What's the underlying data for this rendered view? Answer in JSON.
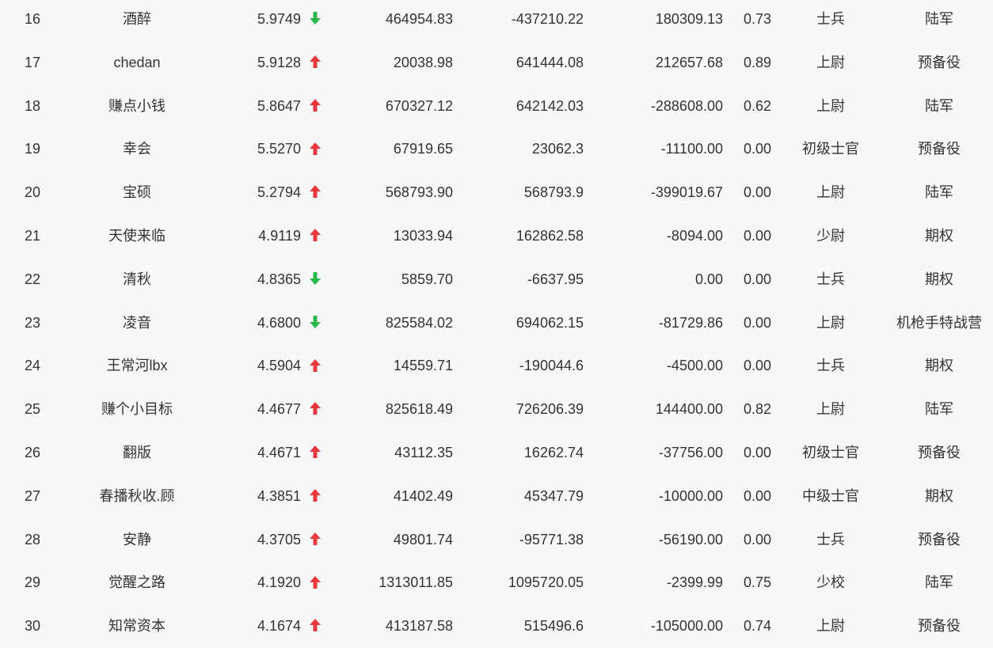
{
  "colors": {
    "up": "#e8383d",
    "down": "#29b84a",
    "text": "#333333",
    "background": "#f7f8fa"
  },
  "rows": [
    {
      "rank": "16",
      "name": "酒醉",
      "ratio": "5.9749",
      "trend": "down",
      "v1": "464954.83",
      "v2": "-437210.22",
      "v3": "180309.13",
      "v4": "0.73",
      "title": "士兵",
      "group": "陆军"
    },
    {
      "rank": "17",
      "name": "chedan",
      "ratio": "5.9128",
      "trend": "up",
      "v1": "20038.98",
      "v2": "641444.08",
      "v3": "212657.68",
      "v4": "0.89",
      "title": "上尉",
      "group": "预备役"
    },
    {
      "rank": "18",
      "name": "赚点小钱",
      "ratio": "5.8647",
      "trend": "up",
      "v1": "670327.12",
      "v2": "642142.03",
      "v3": "-288608.00",
      "v4": "0.62",
      "title": "上尉",
      "group": "陆军"
    },
    {
      "rank": "19",
      "name": "幸会",
      "ratio": "5.5270",
      "trend": "up",
      "v1": "67919.65",
      "v2": "23062.3",
      "v3": "-11100.00",
      "v4": "0.00",
      "title": "初级士官",
      "group": "预备役"
    },
    {
      "rank": "20",
      "name": "宝硕",
      "ratio": "5.2794",
      "trend": "up",
      "v1": "568793.90",
      "v2": "568793.9",
      "v3": "-399019.67",
      "v4": "0.00",
      "title": "上尉",
      "group": "陆军"
    },
    {
      "rank": "21",
      "name": "天使来临",
      "ratio": "4.9119",
      "trend": "up",
      "v1": "13033.94",
      "v2": "162862.58",
      "v3": "-8094.00",
      "v4": "0.00",
      "title": "少尉",
      "group": "期权"
    },
    {
      "rank": "22",
      "name": "清秋",
      "ratio": "4.8365",
      "trend": "down",
      "v1": "5859.70",
      "v2": "-6637.95",
      "v3": "0.00",
      "v4": "0.00",
      "title": "士兵",
      "group": "期权"
    },
    {
      "rank": "23",
      "name": "凌音",
      "ratio": "4.6800",
      "trend": "down",
      "v1": "825584.02",
      "v2": "694062.15",
      "v3": "-81729.86",
      "v4": "0.00",
      "title": "上尉",
      "group": "机枪手特战营"
    },
    {
      "rank": "24",
      "name": "王常河lbx",
      "ratio": "4.5904",
      "trend": "up",
      "v1": "14559.71",
      "v2": "-190044.6",
      "v3": "-4500.00",
      "v4": "0.00",
      "title": "士兵",
      "group": "期权"
    },
    {
      "rank": "25",
      "name": "赚个小目标",
      "ratio": "4.4677",
      "trend": "up",
      "v1": "825618.49",
      "v2": "726206.39",
      "v3": "144400.00",
      "v4": "0.82",
      "title": "上尉",
      "group": "陆军"
    },
    {
      "rank": "26",
      "name": "翻版",
      "ratio": "4.4671",
      "trend": "up",
      "v1": "43112.35",
      "v2": "16262.74",
      "v3": "-37756.00",
      "v4": "0.00",
      "title": "初级士官",
      "group": "预备役"
    },
    {
      "rank": "27",
      "name": "春播秋收.顾",
      "ratio": "4.3851",
      "trend": "up",
      "v1": "41402.49",
      "v2": "45347.79",
      "v3": "-10000.00",
      "v4": "0.00",
      "title": "中级士官",
      "group": "期权"
    },
    {
      "rank": "28",
      "name": "安静",
      "ratio": "4.3705",
      "trend": "up",
      "v1": "49801.74",
      "v2": "-95771.38",
      "v3": "-56190.00",
      "v4": "0.00",
      "title": "士兵",
      "group": "预备役"
    },
    {
      "rank": "29",
      "name": "觉醒之路",
      "ratio": "4.1920",
      "trend": "up",
      "v1": "1313011.85",
      "v2": "1095720.05",
      "v3": "-2399.99",
      "v4": "0.75",
      "title": "少校",
      "group": "陆军"
    },
    {
      "rank": "30",
      "name": "知常资本",
      "ratio": "4.1674",
      "trend": "up",
      "v1": "413187.58",
      "v2": "515496.6",
      "v3": "-105000.00",
      "v4": "0.74",
      "title": "上尉",
      "group": "预备役"
    }
  ]
}
